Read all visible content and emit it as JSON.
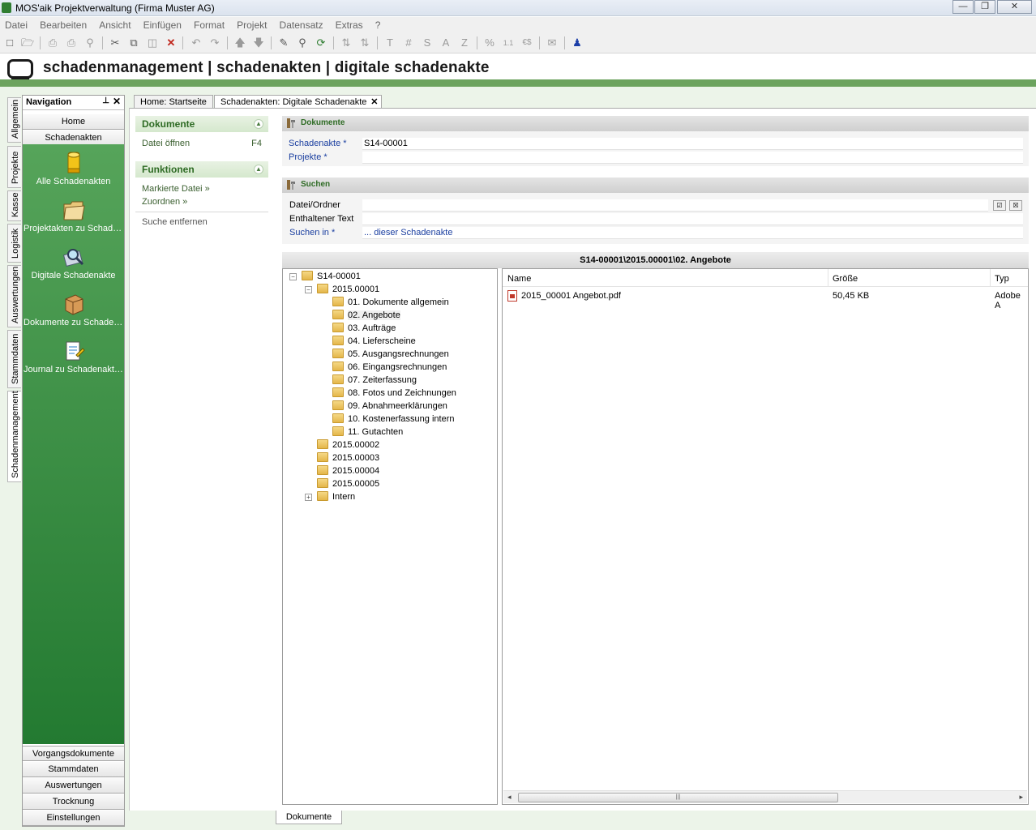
{
  "window": {
    "title": "MOS'aik Projektverwaltung (Firma Muster AG)",
    "minimize": "—",
    "maximize": "❐",
    "close": "✕"
  },
  "menu": [
    "Datei",
    "Bearbeiten",
    "Ansicht",
    "Einfügen",
    "Format",
    "Projekt",
    "Datensatz",
    "Extras",
    "?"
  ],
  "toolbar": {
    "icons": [
      "new-file-icon",
      "open-folder-icon",
      "print-icon",
      "print-preview-icon",
      "page-preview-icon",
      "cut-icon",
      "copy-icon",
      "paste-icon",
      "delete-icon",
      "undo-icon",
      "redo-icon",
      "move-up-icon",
      "move-down-icon",
      "edit-icon",
      "find-icon",
      "refresh-icon",
      "sort-asc-icon",
      "sort-desc-icon"
    ],
    "format_letters": [
      "T",
      "#",
      "S",
      "A",
      "Z"
    ],
    "percent": "%",
    "numbers": "1.1",
    "currency": "€$"
  },
  "header": {
    "title": "schadenmanagement | schadenakten | digitale schadenakte"
  },
  "vertical_tabs": [
    "Allgemein",
    "Projekte",
    "Kasse",
    "Logistik",
    "Auswertungen",
    "Stammdaten",
    "Schadenmanagement"
  ],
  "navigation": {
    "title": "Navigation",
    "pin": "⊥",
    "close": "✕",
    "top_buttons": [
      "Home",
      "Schadenakten"
    ],
    "items": [
      {
        "label": "Alle Schadenakten",
        "icon": "cylinder-icon"
      },
      {
        "label": "Projektakten zu Schade...",
        "icon": "folder-icon"
      },
      {
        "label": "Digitale Schadenakte",
        "icon": "search-document-icon"
      },
      {
        "label": "Dokumente zu Schaden...",
        "icon": "box-icon"
      },
      {
        "label": "Journal zu Schadenakten",
        "icon": "journal-icon"
      }
    ],
    "bottom_buttons": [
      "Vorgangsdokumente",
      "Stammdaten",
      "Auswertungen",
      "Trocknung",
      "Einstellungen"
    ]
  },
  "doc_tabs": [
    {
      "label": "Home: Startseite"
    },
    {
      "label": "Schadenakten: Digitale Schadenakte",
      "close": "✕"
    }
  ],
  "tasks": {
    "dokumente": {
      "title": "Dokumente",
      "items": [
        {
          "label": "Datei öffnen",
          "shortcut": "F4"
        }
      ]
    },
    "funktionen": {
      "title": "Funktionen",
      "items": [
        "Markierte Datei »",
        "Zuordnen »"
      ],
      "extra": "Suche entfernen"
    },
    "collapse_symbol": "▲"
  },
  "form_dokumente": {
    "title": "Dokumente",
    "schadenakte_label": "Schadenakte *",
    "schadenakte_value": "S14-00001",
    "projekte_label": "Projekte *",
    "projekte_value": ""
  },
  "form_suchen": {
    "title": "Suchen",
    "datei_label": "Datei/Ordner",
    "datei_value": "",
    "text_label": "Enthaltener Text",
    "text_value": "",
    "suchen_in_label": "Suchen in *",
    "suchen_in_value": "... dieser Schadenakte",
    "btn_apply": "☑",
    "btn_clear": "☒"
  },
  "path": "S14-00001\\2015.00001\\02. Angebote",
  "tree": {
    "root": "S14-00001",
    "child": "2015.00001",
    "subfolders": [
      "01. Dokumente allgemein",
      "02. Angebote",
      "03. Aufträge",
      "04. Lieferscheine",
      "05. Ausgangsrechnungen",
      "06. Eingangsrechnungen",
      "07. Zeiterfassung",
      "08. Fotos und Zeichnungen",
      "09. Abnahmeerklärungen",
      "10. Kostenerfassung intern",
      "11. Gutachten"
    ],
    "siblings": [
      "2015.00002",
      "2015.00003",
      "2015.00004",
      "2015.00005"
    ],
    "intern": "Intern",
    "minus": "−",
    "plus": "+"
  },
  "files": {
    "columns": [
      "Name",
      "Größe",
      "Typ"
    ],
    "rows": [
      {
        "name": "2015_00001 Angebot.pdf",
        "size": "50,45 KB",
        "type": "Adobe A"
      }
    ],
    "scroll_left": "◂",
    "scroll_right": "▸",
    "grip": "|||"
  },
  "bottom_tab": "Dokumente"
}
